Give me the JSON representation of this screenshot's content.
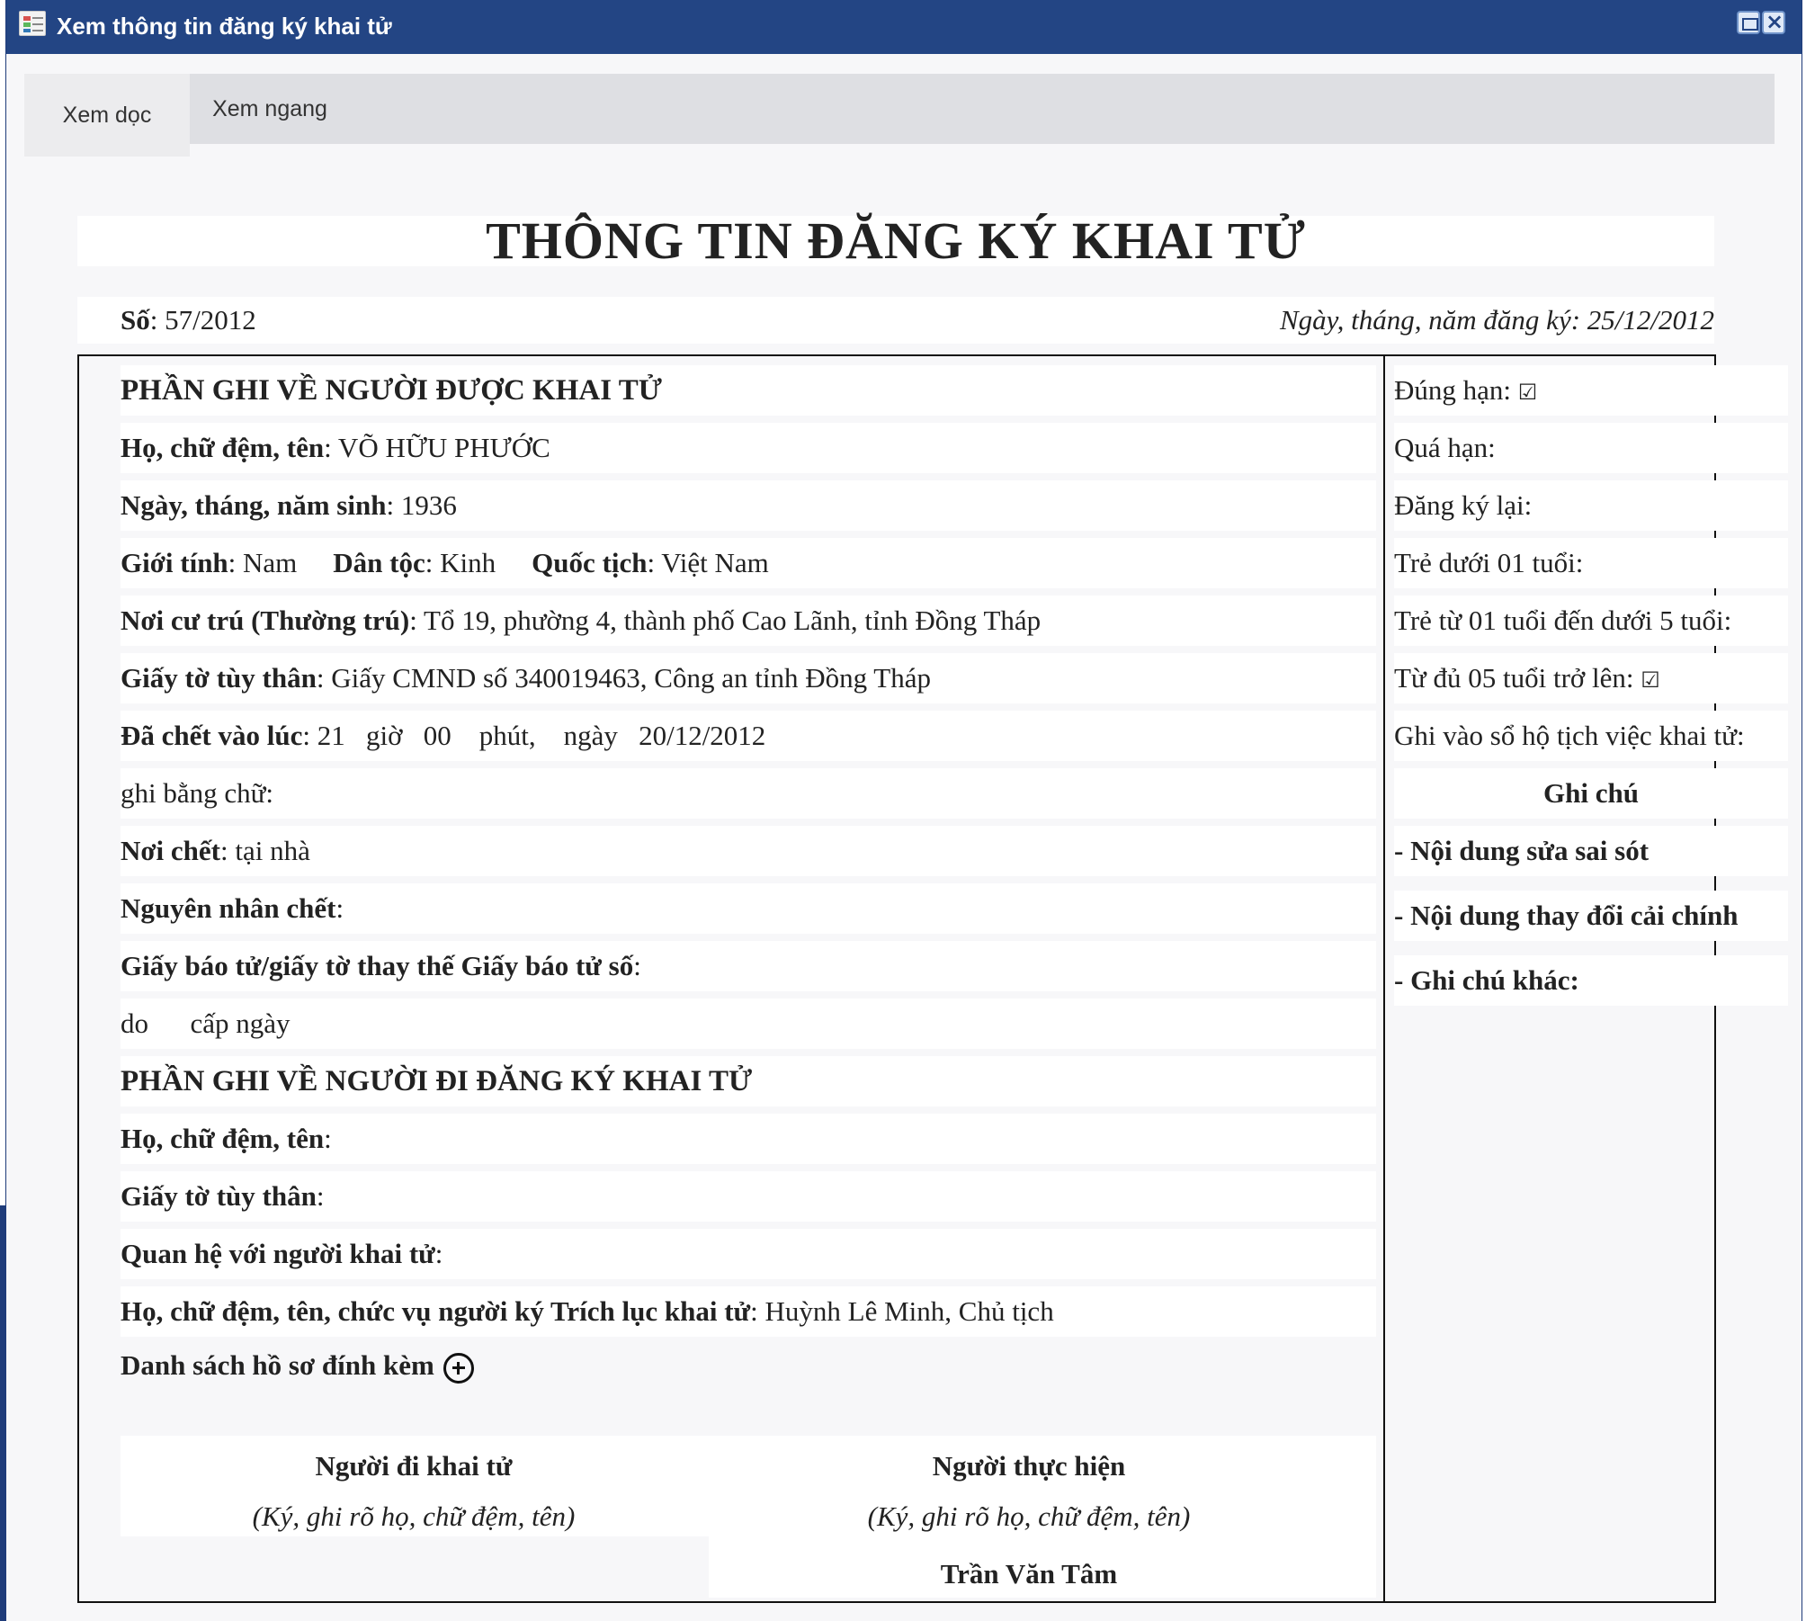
{
  "window": {
    "title": "Xem thông tin đăng ký khai tử"
  },
  "tabs": [
    {
      "label": "Xem dọc"
    },
    {
      "label": "Xem ngang"
    }
  ],
  "document": {
    "title": "THÔNG TIN ĐĂNG KÝ KHAI TỬ",
    "so_label": "Số",
    "so_value": ": 57/2012",
    "ngay_dang_ky": "Ngày, tháng, năm đăng ký:  25/12/2012",
    "deceased": {
      "heading": "PHẦN GHI VỀ NGƯỜI ĐƯỢC KHAI TỬ",
      "name_label": "Họ, chữ đệm, tên",
      "name_value": ": VÕ HỮU PHƯỚC",
      "dob_label": "Ngày, tháng, năm sinh",
      "dob_value": ": 1936",
      "gender_label": "Giới tính",
      "gender_value": ": Nam",
      "ethnic_label": "Dân tộc",
      "ethnic_value": ": Kinh",
      "nationality_label": "Quốc tịch",
      "nationality_value": ":  Việt Nam",
      "residence_label": "Nơi cư trú (Thường trú)",
      "residence_value": ": Tổ 19, phường 4, thành phố Cao Lãnh, tỉnh Đồng Tháp",
      "id_label": "Giấy tờ tùy thân",
      "id_value": ": Giấy CMND số 340019463, Công an tỉnh Đồng Tháp",
      "death_time_label": "Đã chết vào lúc",
      "death_time_value": ": 21   giờ   00    phút,    ngày   20/12/2012",
      "in_words": "ghi bằng chữ:",
      "place_label": "Nơi chết",
      "place_value": ": tại nhà",
      "cause_label": "Nguyên nhân chết",
      "cause_value": ":",
      "notice_label": "Giấy báo tử/giấy tờ thay thế Giấy báo tử số",
      "notice_value": ":",
      "issued_text": "do      cấp ngày"
    },
    "registrant": {
      "heading": "PHẦN GHI VỀ NGƯỜI ĐI ĐĂNG KÝ KHAI TỬ",
      "name_label": "Họ, chữ đệm, tên",
      "name_value": ":",
      "id_label": "Giấy tờ tùy thân",
      "id_value": ":",
      "relation_label": "Quan hệ với người khai tử",
      "relation_value": ":",
      "signer_label": "Họ, chữ đệm, tên, chức vụ người ký Trích lục khai tử",
      "signer_value": ": Huỳnh Lê Minh, Chủ tịch",
      "attachments_label": "Danh sách hồ sơ đính kèm"
    },
    "signatures": {
      "left_title": "Người đi khai tử",
      "left_note": "(Ký, ghi rõ họ, chữ đệm, tên)",
      "right_title": "Người thực hiện",
      "right_note": "(Ký, ghi rõ họ, chữ đệm, tên)",
      "right_name": "Trần Văn Tâm"
    },
    "side": {
      "dung_han": "Đúng hạn:",
      "qua_han": "Quá hạn:",
      "dang_ky_lai": "Đăng ký lại:",
      "tre_duoi_1": "Trẻ dưới 01 tuổi:",
      "tre_1_5": "Trẻ từ 01 tuổi đến dưới 5 tuổi:",
      "tu_5": "Từ đủ 05 tuổi trở lên:",
      "ghi_vao_so": "Ghi vào sổ hộ tịch việc khai tử:",
      "ghi_chu": "Ghi chú",
      "sua_sai": "- Nội dung sửa sai sót",
      "thay_doi": "- Nội dung thay đổi cải chính",
      "ghi_chu_khac": "- Ghi chú khác:",
      "check_mark": "☑"
    }
  }
}
